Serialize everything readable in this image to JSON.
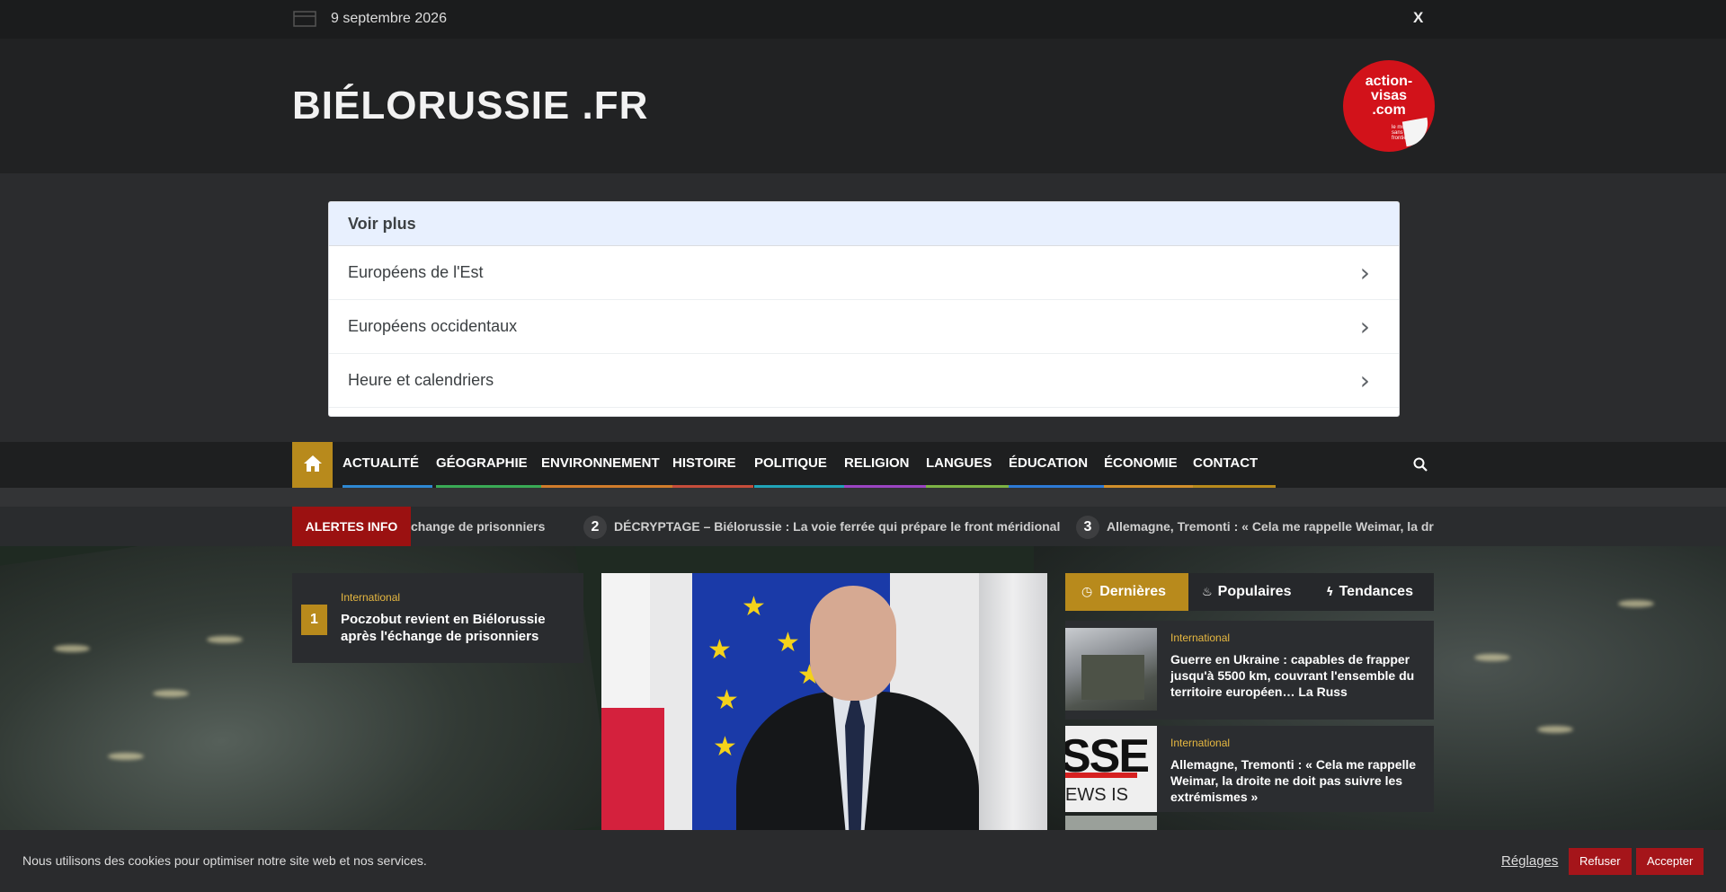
{
  "topbar": {
    "date": "9 septembre 2026",
    "social_icon": "X"
  },
  "header": {
    "site_title": "BIÉLORUSSIE .FR",
    "badge_main": "action-\nvisas\n.com",
    "badge_tag": "le monde sans frontière"
  },
  "widget": {
    "heading": "Voir plus",
    "items": [
      {
        "label": "Européens de l'Est"
      },
      {
        "label": "Européens occidentaux"
      },
      {
        "label": "Heure et calendriers"
      }
    ]
  },
  "nav": {
    "items": [
      {
        "label": "ACTUALITÉ",
        "color": "#2e88d3"
      },
      {
        "label": "GÉOGRAPHIE",
        "color": "#3aaa55"
      },
      {
        "label": "ENVIRONNEMENT",
        "color": "#d17c2b"
      },
      {
        "label": "HISTOIRE",
        "color": "#c64d3b"
      },
      {
        "label": "POLITIQUE",
        "color": "#20a4b8"
      },
      {
        "label": "RELIGION",
        "color": "#9b44c2"
      },
      {
        "label": "LANGUES",
        "color": "#7db344"
      },
      {
        "label": "ÉDUCATION",
        "color": "#2d7ad6"
      },
      {
        "label": "ÉCONOMIE",
        "color": "#d18f2b"
      },
      {
        "label": "CONTACT",
        "color": "#b88a1c"
      }
    ]
  },
  "ticker": {
    "label": "ALERTES INFO",
    "items": [
      {
        "num": "",
        "text": "change de prisonniers"
      },
      {
        "num": "2",
        "text": "DÉCRYPTAGE – Biélorussie : La voie ferrée qui prépare le front méridional"
      },
      {
        "num": "3",
        "text": "Allemagne, Tremonti : « Cela me rappelle Weimar, la droite ne doit pas suivre les extrémismes »"
      }
    ]
  },
  "featured": {
    "rank": "1",
    "category": "International",
    "title": "Poczobut revient en Biélorussie après l'échange de prisonniers"
  },
  "tabs": [
    {
      "label": "Dernières",
      "icon": "clock-icon"
    },
    {
      "label": "Populaires",
      "icon": "flame-icon"
    },
    {
      "label": "Tendances",
      "icon": "bolt-icon"
    }
  ],
  "side_posts": [
    {
      "category": "International",
      "title": "Guerre en Ukraine : capables de frapper jusqu'à 5500 km, couvrant l'ensemble du territoire européen… La Russ"
    },
    {
      "category": "International",
      "title": "Allemagne, Tremonti : « Cela me rappelle Weimar, la droite ne doit pas suivre les extrémismes »"
    }
  ],
  "cookie": {
    "message": "Nous utilisons des cookies pour optimiser notre site web et nos services.",
    "settings": "Réglages",
    "refuse": "Refuser",
    "accept": "Accepter"
  }
}
